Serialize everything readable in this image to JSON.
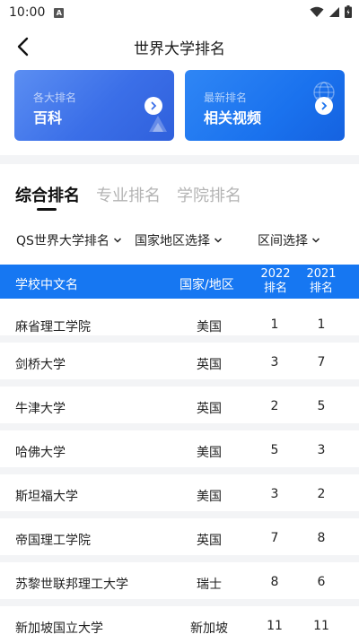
{
  "status": {
    "time": "10:00",
    "icon_letter": "A"
  },
  "header": {
    "title": "世界大学排名"
  },
  "banners": [
    {
      "sub": "各大排名",
      "title": "百科"
    },
    {
      "sub": "最新排名",
      "title": "相关视频"
    }
  ],
  "tabs": [
    {
      "label": "综合排名",
      "active": true
    },
    {
      "label": "专业排名",
      "active": false
    },
    {
      "label": "学院排名",
      "active": false
    }
  ],
  "filters": [
    {
      "label": "QS世界大学排名"
    },
    {
      "label": "国家地区选择"
    },
    {
      "label": "区间选择"
    }
  ],
  "table": {
    "headers": {
      "name": "学校中文名",
      "country": "国家/地区",
      "y2022_line1": "2022",
      "y2022_line2": "排名",
      "y2021_line1": "2021",
      "y2021_line2": "排名"
    },
    "rows": [
      {
        "name": "麻省理工学院",
        "country": "美国",
        "r2022": "1",
        "r2021": "1"
      },
      {
        "name": "剑桥大学",
        "country": "英国",
        "r2022": "3",
        "r2021": "7"
      },
      {
        "name": "牛津大学",
        "country": "英国",
        "r2022": "2",
        "r2021": "5"
      },
      {
        "name": "哈佛大学",
        "country": "美国",
        "r2022": "5",
        "r2021": "3"
      },
      {
        "name": "斯坦福大学",
        "country": "美国",
        "r2022": "3",
        "r2021": "2"
      },
      {
        "name": "帝国理工学院",
        "country": "英国",
        "r2022": "7",
        "r2021": "8"
      },
      {
        "name": "苏黎世联邦理工大学",
        "country": "瑞士",
        "r2022": "8",
        "r2021": "6"
      },
      {
        "name": "新加坡国立大学",
        "country": "新加坡",
        "r2022": "11",
        "r2021": "11"
      }
    ]
  },
  "colors": {
    "accent": "#1677f2",
    "band": "#f3f4f6"
  }
}
